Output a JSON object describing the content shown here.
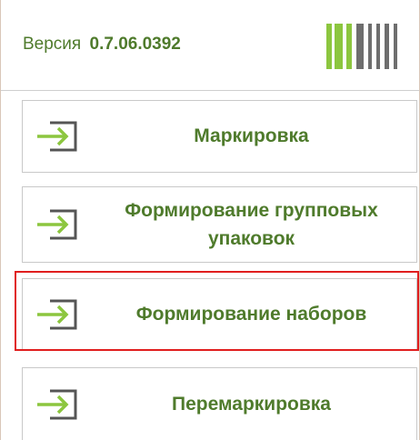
{
  "header": {
    "version_label": "Версия",
    "version_number": "0.7.06.0392",
    "logo_icon": "barcode-logo-icon"
  },
  "menu": {
    "items": [
      {
        "label": "Маркировка",
        "icon": "login-arrow-icon"
      },
      {
        "label": "Формирование групповых упаковок",
        "icon": "login-arrow-icon"
      },
      {
        "label": "Формирование наборов",
        "icon": "login-arrow-icon",
        "highlighted": true
      },
      {
        "label": "Перемаркировка",
        "icon": "login-arrow-icon"
      }
    ]
  },
  "colors": {
    "accent_text": "#4f7b2c",
    "arrow_green": "#8cc63f",
    "icon_gray": "#555555",
    "highlight_border": "#e01e1e"
  }
}
